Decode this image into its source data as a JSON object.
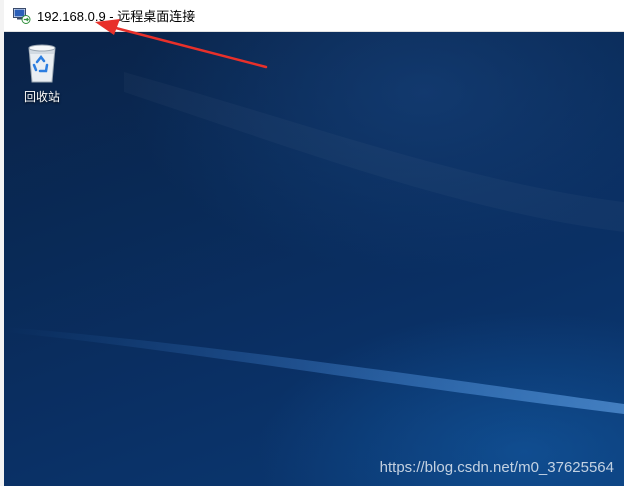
{
  "window": {
    "title": "192.168.0.9 - 远程桌面连接",
    "app_icon": "remote-desktop-icon"
  },
  "desktop": {
    "icons": [
      {
        "label": "回收站",
        "icon": "recycle-bin-icon"
      }
    ]
  },
  "watermark": "https://blog.csdn.net/m0_37625564",
  "colors": {
    "desktop_base": "#0a2f63",
    "annotation_arrow": "#e8302a",
    "titlebar": "#ffffff"
  }
}
